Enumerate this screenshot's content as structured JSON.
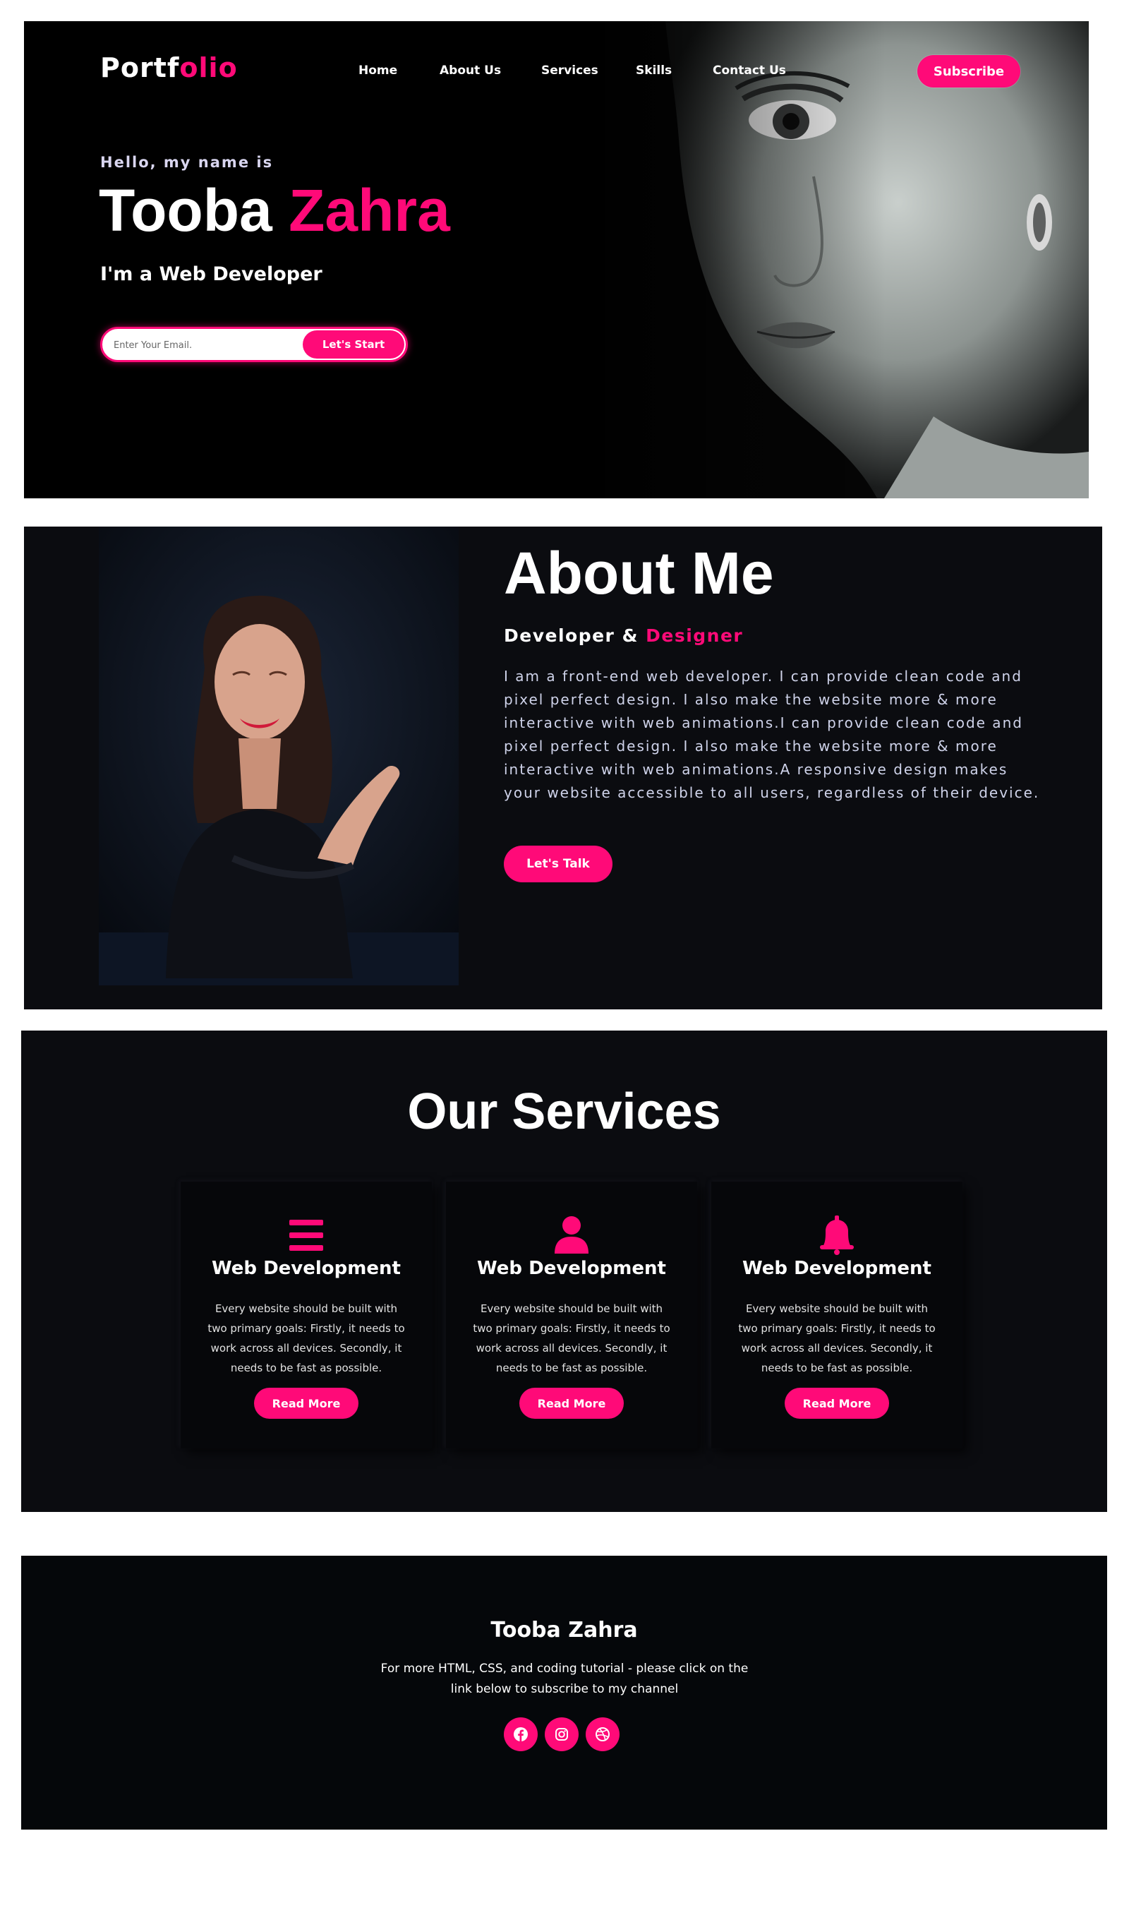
{
  "colors": {
    "accent": "#ff0a78",
    "background": "#0b0c10",
    "hero_bg": "#000000"
  },
  "header": {
    "logo_white": "Portf",
    "logo_pink": "olio",
    "nav": [
      "Home",
      "About Us",
      "Services",
      "Skills",
      "Contact Us"
    ],
    "subscribe_label": "Subscribe"
  },
  "hero": {
    "greeting": "Hello, my name is",
    "first_name": "Tooba",
    "last_name": "Zahra",
    "role": "I'm a Web Developer",
    "email_placeholder": "Enter Your Email.",
    "start_label": "Let's Start"
  },
  "about": {
    "title": "About Me",
    "subtitle_white": "Developer &",
    "subtitle_pink": "Designer",
    "text": "I am a front-end web developer. I can provide clean code and pixel perfect design. I also make the website more & more interactive with web animations.I can provide clean code and pixel perfect design. I also make the website more & more interactive with web animations.A responsive design makes your website accessible to all users, regardless of their device.",
    "button_label": "Let's Talk"
  },
  "services": {
    "title": "Our Services",
    "cards": [
      {
        "icon": "menu-bars-icon",
        "title": "Web Development",
        "text": "Every website should be built with two primary goals: Firstly, it needs to work across all devices. Secondly, it needs to be fast as possible.",
        "button": "Read More"
      },
      {
        "icon": "user-icon",
        "title": "Web Development",
        "text": "Every website should be built with two primary goals: Firstly, it needs to work across all devices. Secondly, it needs to be fast as possible.",
        "button": "Read More"
      },
      {
        "icon": "bell-icon",
        "title": "Web Development",
        "text": "Every website should be built with two primary goals: Firstly, it needs to work across all devices. Secondly, it needs to be fast as possible.",
        "button": "Read More"
      }
    ]
  },
  "footer": {
    "name": "Tooba Zahra",
    "text": "For more HTML, CSS, and coding tutorial - please click on the link below to subscribe to my channel",
    "social": [
      "facebook-icon",
      "instagram-icon",
      "dribbble-icon"
    ]
  }
}
